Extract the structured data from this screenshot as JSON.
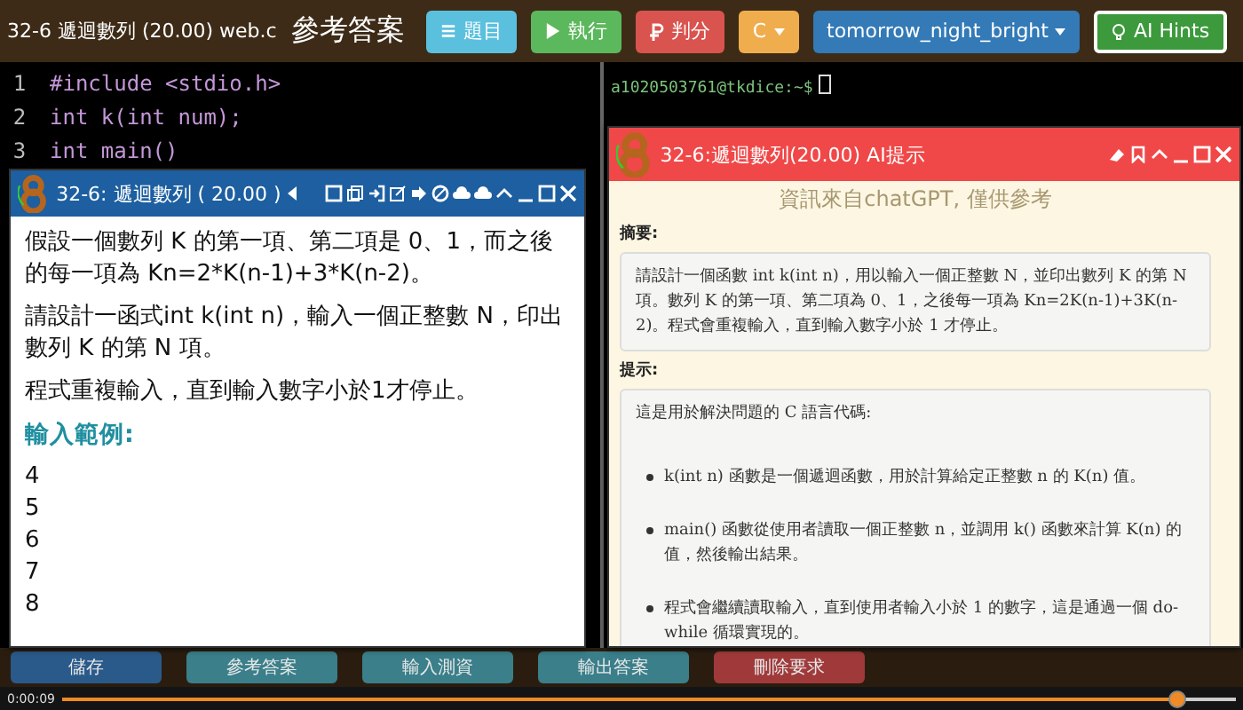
{
  "header": {
    "title": "32-6 遞迴數列 (20.00) web.c",
    "subtitle": "參考答案"
  },
  "toolbar": [
    {
      "kind": "problem",
      "label": "題目",
      "color": "#5bc0de"
    },
    {
      "kind": "run",
      "label": "執行",
      "color": "#5cb85c"
    },
    {
      "kind": "grade",
      "label": "判分",
      "color": "#d9534f"
    },
    {
      "kind": "language",
      "label": "C",
      "color": "#f0ad4e"
    },
    {
      "kind": "theme",
      "label": "tomorrow_night_bright",
      "color": "#337ab7"
    },
    {
      "kind": "hints",
      "label": "AI Hints",
      "color": "#3c9a3c"
    }
  ],
  "editor": {
    "lines": [
      {
        "number": "1",
        "code": "#include <stdio.h>"
      },
      {
        "number": "2",
        "code": "int k(int num);"
      },
      {
        "number": "3",
        "code": "int main()"
      }
    ]
  },
  "terminal": {
    "prompt": "a1020503761@tkdice:~$"
  },
  "problem_window": {
    "title": "32-6: 遞迴數列 ( 20.00 )",
    "paragraphs": [
      "假設一個數列 K 的第一項、第二項是 0、1，而之後的每一項為 Kn=2*K(n-1)+3*K(n-2)。",
      "請設計一函式int k(int n)，輸入一個正整數 N，印出數列 K 的第 N 項。",
      "程式重複輸入，直到輸入數字小於1才停止。"
    ],
    "sample_heading": "輸入範例:",
    "sample_lines": [
      "4",
      "5",
      "6",
      "7",
      "8"
    ]
  },
  "ai_window": {
    "title": "32-6:遞迴數列(20.00) AI提示",
    "notice": "資訊來自chatGPT, 僅供參考",
    "sections": [
      {
        "heading": "摘要:",
        "intro": "請設計一個函數 int k(int n)，用以輸入一個正整數 N，並印出數列 K 的第 N 項。數列 K 的第一項、第二項為 0、1，之後每一項為 Kn=2K(n-1)+3K(n-2)。程式會重複輸入，直到輸入數字小於 1 才停止。"
      },
      {
        "heading": "提示:",
        "intro": "這是用於解決問題的 C 語言代碼:",
        "bullets": [
          "k(int n) 函數是一個遞迴函數，用於計算給定正整數 n 的 K(n) 值。",
          "main() 函數從使用者讀取一個正整數 n，並調用 k() 函數來計算 K(n) 的值，然後輸出結果。",
          "程式會繼續讀取輸入，直到使用者輸入小於 1 的數字，這是通過一個 do-while 循環實現的。"
        ]
      }
    ]
  },
  "bottom_buttons": [
    {
      "label": "儲存",
      "color": "#2a5a8a"
    },
    {
      "label": "參考答案",
      "color": "#3a7f8a"
    },
    {
      "label": "輸入測資",
      "color": "#3a7f8a"
    },
    {
      "label": "輸出答案",
      "color": "#3a7f8a"
    },
    {
      "label": "刪除要求",
      "color": "#a03a3a"
    }
  ],
  "video": {
    "time": "0:00:09",
    "level": 0.95
  }
}
